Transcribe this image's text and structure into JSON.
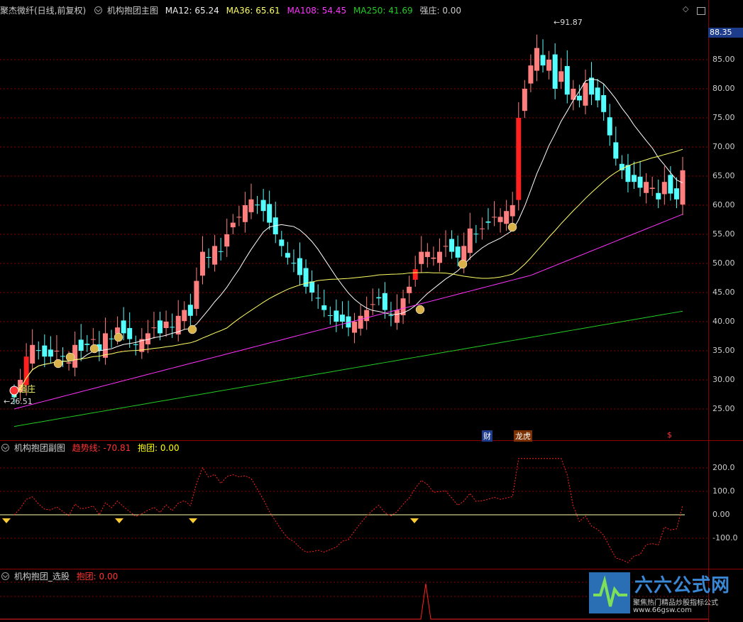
{
  "main_header": {
    "stock": "聚杰微纤(日线,前复权)",
    "indicator": "机构抱团主图",
    "ma12": "MA12: 65.24",
    "ma36": "MA36: 65.61",
    "ma108": "MA108: 54.45",
    "ma250": "MA250: 41.69",
    "qz": "强庄: 0.00"
  },
  "sub1_header": {
    "name": "机构抱团副图",
    "trend": "趋势线: -70.81",
    "bt": "抱团: 0.00"
  },
  "sub2_header": {
    "name": "机构抱团_选股",
    "bt": "抱团: 0.00"
  },
  "current_price": "88.35",
  "high_label": "91.87",
  "low_label": "26.51",
  "qz_label": "强庄",
  "markers": {
    "cai": "财",
    "longhu": "龙虎",
    "dollar": "$"
  },
  "main_ticks": [
    "85.00",
    "80.00",
    "75.00",
    "70.00",
    "65.00",
    "60.00",
    "55.00",
    "50.00",
    "45.00",
    "40.00",
    "35.00",
    "30.00",
    "25.00"
  ],
  "sub1_ticks": [
    "200.0",
    "100.0",
    "0.00",
    "-100.0"
  ],
  "logo": {
    "brand": "六六公式网",
    "slogan": "聚焦热门精品炒股指标公式",
    "url": "www.66gsw.com"
  },
  "colors": {
    "up": "#ff7f7f",
    "down": "#54ffff",
    "ma12": "#ffffff",
    "ma36": "#ffff66",
    "ma108": "#ff33ff",
    "ma250": "#22cc22",
    "grid": "#8b0000"
  }
}
